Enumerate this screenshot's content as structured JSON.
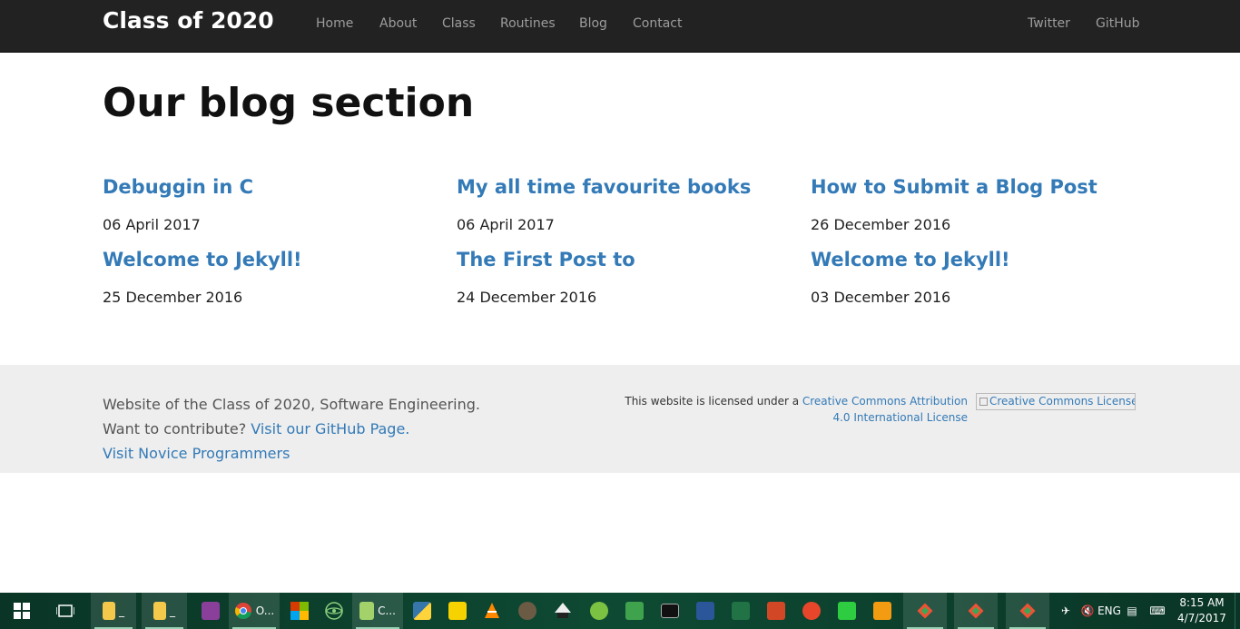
{
  "nav": {
    "brand": "Class of 2020",
    "links": [
      "Home",
      "About",
      "Class",
      "Routines",
      "Blog",
      "Contact"
    ],
    "right_links": [
      "Twitter",
      "GitHub"
    ]
  },
  "main": {
    "title": "Our blog section",
    "posts": [
      {
        "title": "Debuggin in C",
        "date": "06 April 2017"
      },
      {
        "title": "My all time favourite books",
        "date": "06 April 2017"
      },
      {
        "title": "How to Submit a Blog Post",
        "date": "26 December 2016"
      },
      {
        "title": "Welcome to Jekyll!",
        "date": "25 December 2016"
      },
      {
        "title": "The First Post to",
        "date": "24 December 2016"
      },
      {
        "title": "Welcome to Jekyll!",
        "date": "03 December 2016"
      }
    ]
  },
  "footer": {
    "line1": "Website of the Class of 2020, Software Engineering.",
    "line2_prefix": "Want to contribute? ",
    "line2_link": "Visit our GitHub Page.",
    "line3_link": "Visit Novice Programmers",
    "license_prefix": "This website is licensed under a ",
    "license_link_1": "Creative Commons Attribution",
    "license_link_2": "4.0 International License",
    "license_img_alt": "Creative Commons License"
  },
  "taskbar": {
    "items": [
      {
        "icon": "start-icon"
      },
      {
        "icon": "task-view-icon"
      },
      {
        "icon": "file-explorer-icon",
        "label": "_"
      },
      {
        "icon": "file-explorer-icon",
        "label": "_"
      },
      {
        "icon": "winrar-icon"
      },
      {
        "icon": "chrome-icon",
        "label": "O..."
      },
      {
        "icon": "app-icon"
      },
      {
        "icon": "atom-icon"
      },
      {
        "icon": "notepad-icon",
        "label": "C..."
      },
      {
        "icon": "python-icon"
      },
      {
        "icon": "pdf-icon"
      },
      {
        "icon": "vlc-icon"
      },
      {
        "icon": "gimp-icon"
      },
      {
        "icon": "inkscape-icon"
      },
      {
        "icon": "app-icon"
      },
      {
        "icon": "camtasia-icon"
      },
      {
        "icon": "terminal-icon"
      },
      {
        "icon": "word-icon"
      },
      {
        "icon": "excel-icon"
      },
      {
        "icon": "powerpoint-icon"
      },
      {
        "icon": "ccleaner-icon"
      },
      {
        "icon": "settings-icon"
      },
      {
        "icon": "media-player-icon"
      },
      {
        "icon": "git-icon"
      },
      {
        "icon": "git-icon"
      },
      {
        "icon": "git-icon"
      }
    ],
    "time": "8:15 AM",
    "date": "4/7/2017"
  }
}
